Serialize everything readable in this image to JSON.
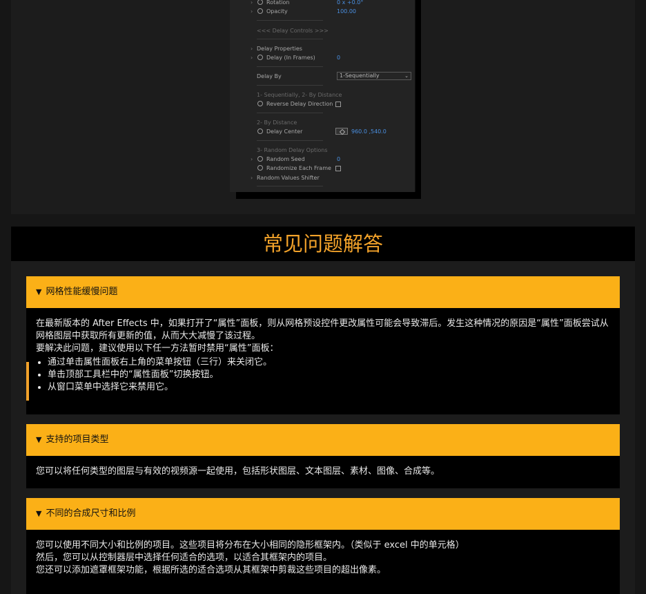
{
  "ae_panel": {
    "rows": [
      {
        "type": "prop",
        "label": "Rotation",
        "value": "0 x +0.0°"
      },
      {
        "type": "prop",
        "label": "Opacity",
        "value": "100.00"
      },
      {
        "type": "section",
        "label": "<<< Delay Controls >>>"
      },
      {
        "type": "group",
        "label": "Delay Properties"
      },
      {
        "type": "prop",
        "label": "Delay (In Frames)",
        "value": "0"
      },
      {
        "type": "select",
        "label": "Delay By",
        "value": "1-Sequentially"
      },
      {
        "type": "section",
        "label": "1- Sequentially, 2- By Distance"
      },
      {
        "type": "checkbox",
        "label": "Reverse Delay Direction"
      },
      {
        "type": "section",
        "label": "2- By Distance"
      },
      {
        "type": "point",
        "label": "Delay Center",
        "value": "960.0 ,540.0"
      },
      {
        "type": "section",
        "label": "3- Random Delay Options"
      },
      {
        "type": "prop",
        "label": "Random Seed",
        "value": "0"
      },
      {
        "type": "checkbox",
        "label": "Randomize Each Frame"
      },
      {
        "type": "group",
        "label": "Random Values Shifter"
      }
    ]
  },
  "faq": {
    "title": "常见问题解答",
    "items": [
      {
        "question": "网格性能缓慢问题",
        "paragraphs": [
          "在最新版本的 After Effects 中，如果打开了“属性”面板，则从网格预设控件更改属性可能会导致滞后。发生这种情况的原因是“属性”面板尝试从网格图层中获取所有更新的值，从而大大减慢了该过程。",
          "要解决此问题，建议使用以下任一方法暂时禁用“属性”面板："
        ],
        "bullets": [
          "通过单击属性面板右上角的菜单按钮（三行）来关闭它。",
          "单击顶部工具栏中的“属性面板”切换按钮。",
          "从窗口菜单中选择它来禁用它。"
        ]
      },
      {
        "question": "支持的项目类型",
        "paragraphs": [
          "您可以将任何类型的图层与有效的视频源一起使用，包括形状图层、文本图层、素材、图像、合成等。"
        ]
      },
      {
        "question": "不同的合成尺寸和比例",
        "paragraphs": [
          "您可以使用不同大小和比例的项目。这些项目将分布在大小相同的隐形框架内。（类似于 excel 中的单元格）",
          "然后，您可以从控制器层中选择任何适合的选项，以适合其框架内的项目。",
          "您还可以添加遮罩框架功能，根据所选的适合选项从其框架中剪裁这些项目的超出像素。"
        ]
      }
    ]
  },
  "colors": {
    "accent": "#fbb017",
    "title": "#f2a22a",
    "value_blue": "#4a90e2"
  }
}
